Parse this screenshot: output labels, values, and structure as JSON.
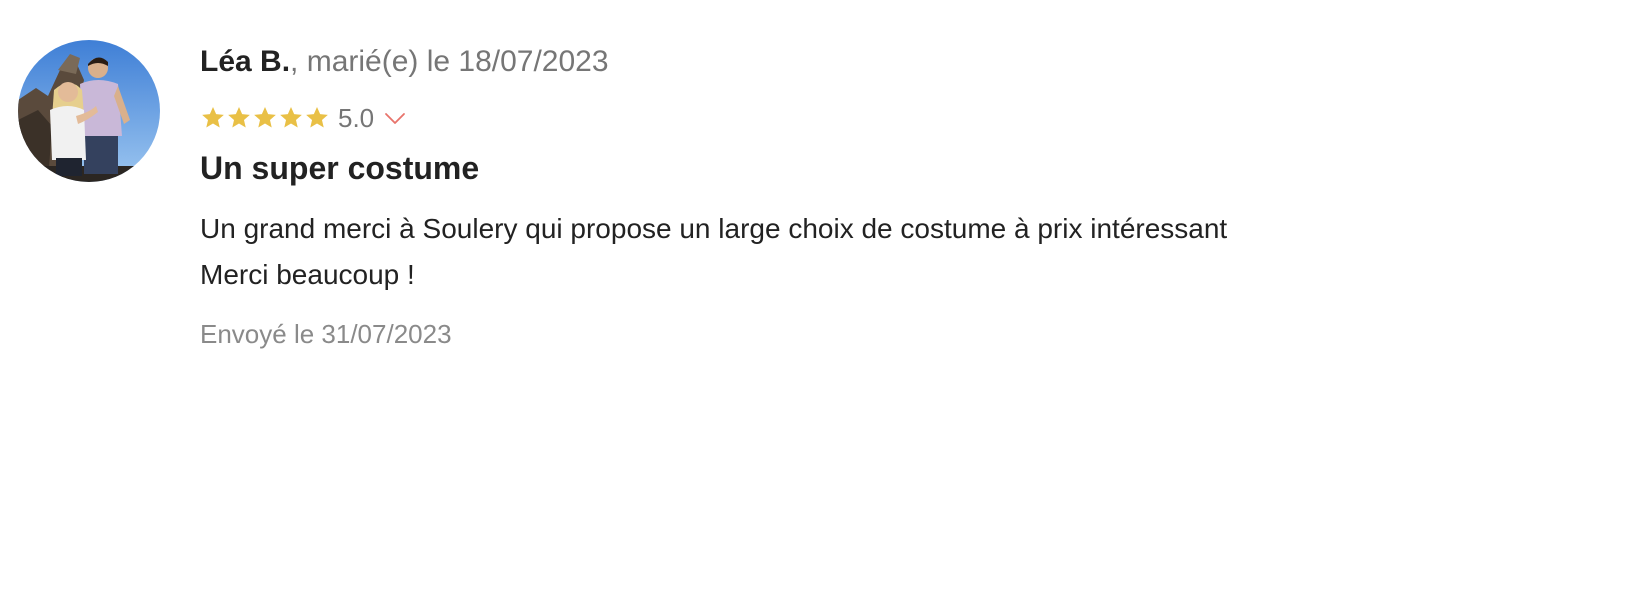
{
  "review": {
    "author": {
      "name": "Léa B.",
      "separator": ", ",
      "wedding_text": "marié(e) le 18/07/2023",
      "avatar_icon": "couple-photo-avatar"
    },
    "rating": {
      "stars": 5,
      "max_stars": 5,
      "value_label": "5.0",
      "star_color": "#E9C046",
      "chevron_color": "#E8736B",
      "expand_icon": "chevron-down-icon"
    },
    "title": "Un super costume",
    "body_lines": [
      "Un grand merci à Soulery qui propose un large choix de costume à prix intéressant",
      "Merci beaucoup !"
    ],
    "sent_label": "Envoyé le 31/07/2023"
  }
}
